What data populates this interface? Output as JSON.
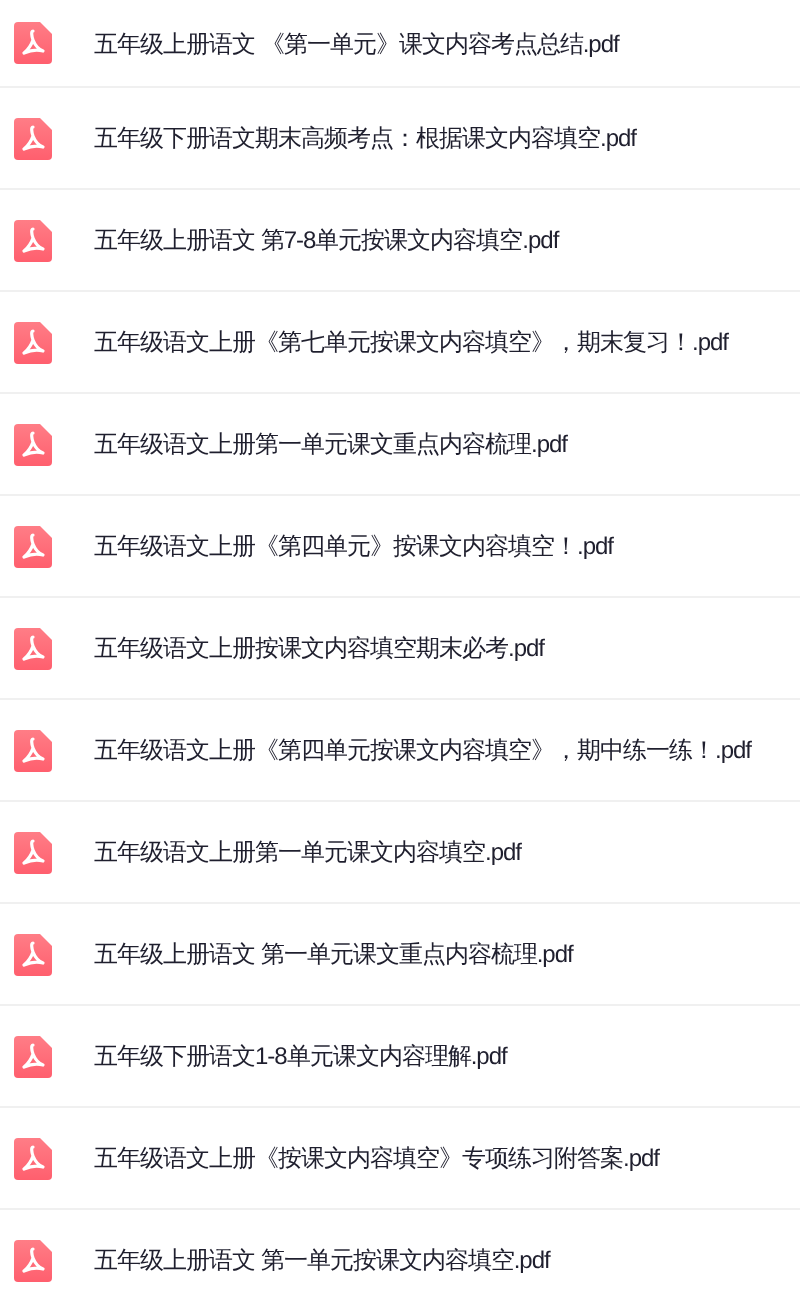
{
  "files": [
    {
      "name": "五年级上册语文 《第一单元》课文内容考点总结.pdf"
    },
    {
      "name": "五年级下册语文期末高频考点：根据课文内容填空.pdf"
    },
    {
      "name": "五年级上册语文 第7-8单元按课文内容填空.pdf"
    },
    {
      "name": "五年级语文上册《第七单元按课文内容填空》，期末复习！.pdf"
    },
    {
      "name": "五年级语文上册第一单元课文重点内容梳理.pdf"
    },
    {
      "name": "五年级语文上册《第四单元》按课文内容填空！.pdf"
    },
    {
      "name": "五年级语文上册按课文内容填空期末必考.pdf"
    },
    {
      "name": "五年级语文上册《第四单元按课文内容填空》，期中练一练！.pdf"
    },
    {
      "name": "五年级语文上册第一单元课文内容填空.pdf"
    },
    {
      "name": "五年级上册语文 第一单元课文重点内容梳理.pdf"
    },
    {
      "name": "五年级下册语文1-8单元课文内容理解.pdf"
    },
    {
      "name": "五年级语文上册《按课文内容填空》专项练习附答案.pdf"
    },
    {
      "name": "五年级上册语文 第一单元按课文内容填空.pdf"
    }
  ]
}
